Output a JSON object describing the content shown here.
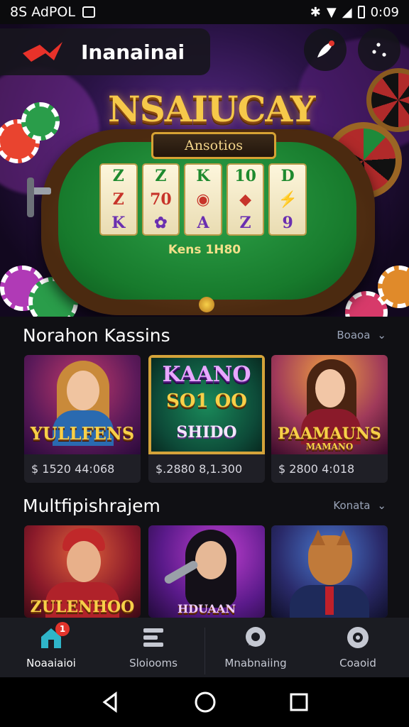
{
  "status_bar": {
    "left_text": "8S AdPOL",
    "time": "0:09"
  },
  "header": {
    "app_title": "Inanainai"
  },
  "hero": {
    "marquee": "NSAIUCAY",
    "plaque": "Ansotios",
    "reels": [
      [
        "Z",
        "Z",
        "K"
      ],
      [
        "Z",
        "70",
        "✿"
      ],
      [
        "K",
        "◉",
        "A"
      ],
      [
        "10",
        "◆",
        "Z"
      ],
      [
        "D",
        "⚡",
        "9"
      ]
    ],
    "table_caption": "Kens 1H80"
  },
  "section1": {
    "title": "Norahon Kassins",
    "see_all": "Boaoa",
    "cards": [
      {
        "art_title": "YULLFENS",
        "price": "$ 1520 44:068"
      },
      {
        "art_title_top": "KAANO",
        "art_title_mid": "SO1 OO",
        "art_title_bottom": "SHIDO",
        "price": "$.2880 8,1.300"
      },
      {
        "art_title": "PAAMAUNS",
        "art_subtitle": "MAMANO",
        "price": "$ 2800 4:018"
      }
    ]
  },
  "section2": {
    "title": "Multfipishrajem",
    "see_all": "Konata",
    "cards": [
      {
        "art_title": "ZULENHOO"
      },
      {
        "art_title": "HDUAAN"
      },
      {
        "art_title": ""
      }
    ]
  },
  "bottom_nav": {
    "items": [
      {
        "label": "Noaaiaioi",
        "icon": "home-icon",
        "badge": "1"
      },
      {
        "label": "Sloiooms",
        "icon": "slots-icon"
      },
      {
        "label": "Mnabnaiing",
        "icon": "chat-icon"
      },
      {
        "label": "Coaoid",
        "icon": "gear-icon"
      }
    ]
  },
  "colors": {
    "accent_gold": "#f7d049",
    "nav_bg": "#1b1c22",
    "badge_red": "#e2342c",
    "icon_teal": "#2fb5c9"
  }
}
